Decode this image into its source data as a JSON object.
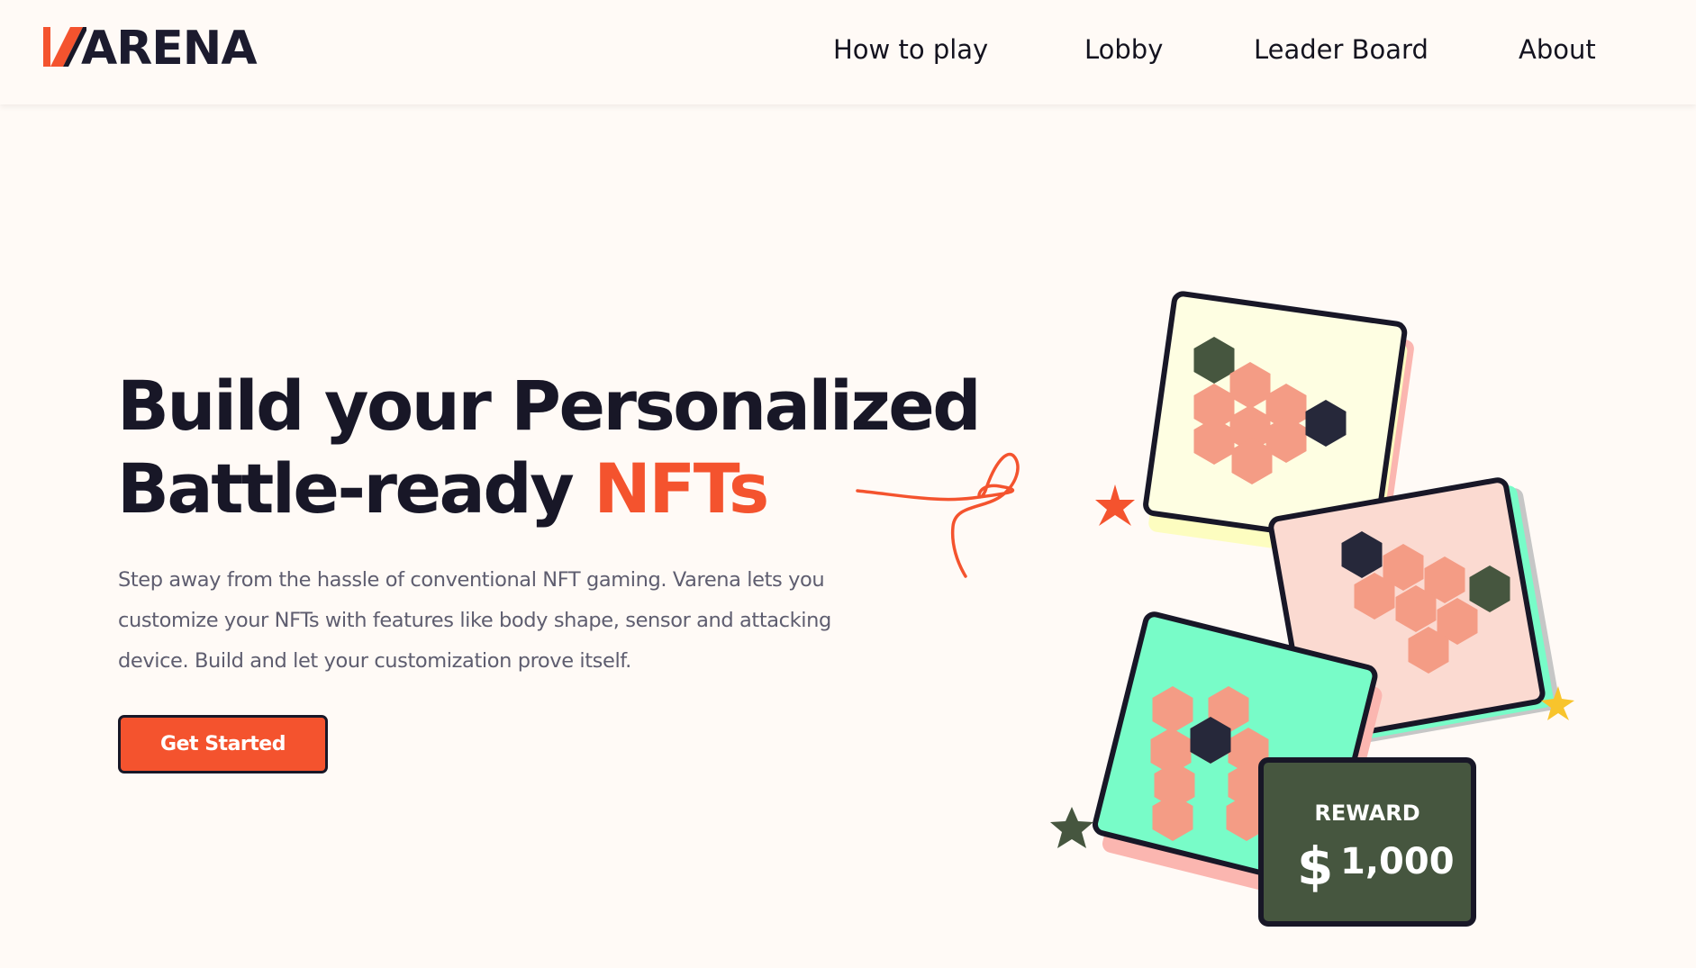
{
  "brand": {
    "logo_text": "ARENA"
  },
  "nav": {
    "items": [
      {
        "label": "How to play"
      },
      {
        "label": "Lobby"
      },
      {
        "label": "Leader Board"
      },
      {
        "label": "About"
      }
    ]
  },
  "hero": {
    "title_line1": "Build your Personalized",
    "title_line2_plain": "Battle-ready ",
    "title_line2_accent": "NFTs",
    "description": "Step away from the hassle of conventional NFT gaming. Varena lets you customize your NFTs with features like body shape, sensor and attacking device. Build and let your customization prove itself.",
    "cta_label": "Get Started"
  },
  "reward_card": {
    "label": "REWARD",
    "currency": "$",
    "amount": "1,000"
  },
  "colors": {
    "accent": "#f4532e",
    "dark": "#181727",
    "background": "#fffaf6",
    "hex_salmon": "#f49c85",
    "hex_green": "#46563f",
    "card_cream": "#fefee2",
    "card_pink": "#fbdad1",
    "card_mint": "#78fcc8",
    "star_yellow": "#f8c42c"
  },
  "icons": [
    "varena-logo-icon",
    "squiggle-decoration-icon",
    "star-icon",
    "hexagon-icon"
  ]
}
